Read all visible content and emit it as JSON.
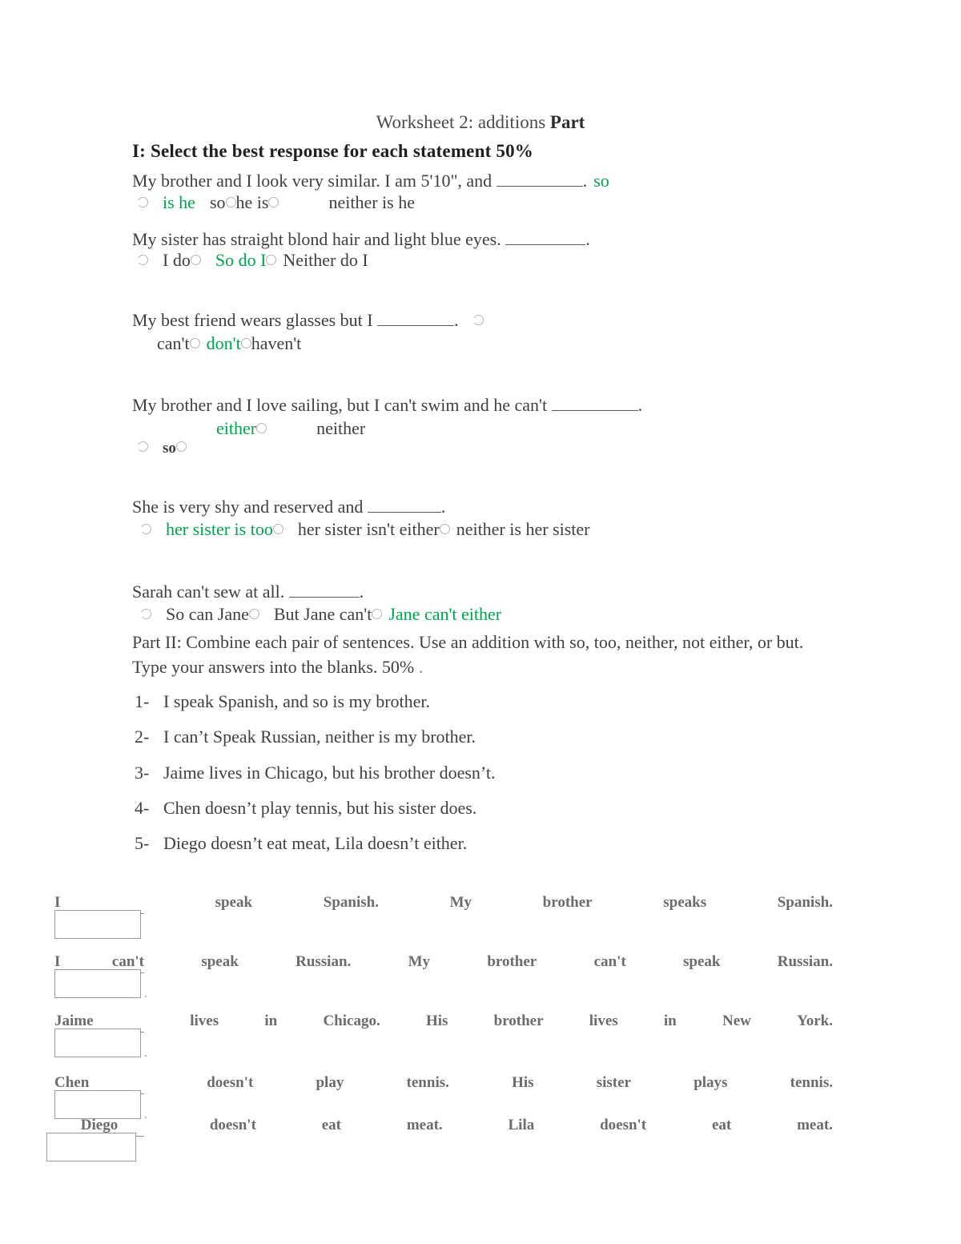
{
  "document": {
    "title_regular": "Worksheet 2: additions ",
    "title_bold": "Part",
    "heading": "I: Select the best response for each statement 50%"
  },
  "part1": {
    "questions": [
      {
        "stem_before": "My brother and I look very similar. I am 5'10\", and ",
        "stem_after": ".",
        "trailing_option": "so",
        "options": [
          "is he",
          "so",
          "he is",
          "neither is he"
        ],
        "selected_answer": "so is he"
      },
      {
        "stem_before": "My sister has straight blond hair and light blue eyes. ",
        "stem_after": ".",
        "options": [
          "I do",
          "So do I",
          "Neither do I"
        ],
        "selected_answer": "So do I"
      },
      {
        "stem_before": "My best friend wears glasses but I ",
        "stem_after": ".",
        "options": [
          "can't",
          "don't",
          "haven't"
        ],
        "selected_answer": "don't"
      },
      {
        "stem_before": "My brother and I love sailing, but I can't swim and he can't ",
        "stem_after": ".",
        "options": [
          "either",
          "neither",
          "so"
        ],
        "selected_answer": "either"
      },
      {
        "stem_before": "She is very shy and reserved and ",
        "stem_after": ".",
        "options": [
          "her sister is too",
          "her sister isn't either",
          "neither is her sister"
        ],
        "selected_answer": "her sister is too"
      },
      {
        "stem_before": "Sarah can't sew at all. ",
        "stem_after": ".",
        "options": [
          "So can Jane",
          "But Jane can't",
          "Jane can't either"
        ],
        "selected_answer": "Jane can't either"
      }
    ]
  },
  "part2": {
    "instructions": "Part II: Combine each pair of sentences. Use an addition with so, too, neither, not either, or but. Type your answers into the blanks. 50%",
    "answers": [
      {
        "number": "1-",
        "text": "I speak Spanish, and so is my brother."
      },
      {
        "number": "2-",
        "text": "I can’t Speak Russian, neither is my brother."
      },
      {
        "number": "3-",
        "text": "Jaime lives in Chicago, but his brother doesn’t."
      },
      {
        "number": "4-",
        "text": "Chen doesn’t play tennis, but his sister does."
      },
      {
        "number": "5-",
        "text": "Diego doesn’t eat meat, Lila doesn’t either."
      }
    ],
    "exercise_rows": [
      {
        "lead": "I",
        "lead_extra": "",
        "words": [
          "speak",
          "Spanish.",
          "My",
          "brother",
          "speaks",
          "Spanish."
        ],
        "input_value": "",
        "trailing_dot": ""
      },
      {
        "lead": "I",
        "lead_extra": "can't",
        "words": [
          "speak",
          "Russian.",
          "My",
          "brother",
          "can't",
          "speak",
          "Russian."
        ],
        "input_value": "",
        "trailing_dot": "."
      },
      {
        "lead": "Jaime",
        "lead_extra": "",
        "words": [
          "lives",
          "in",
          "Chicago.",
          "His",
          "brother",
          "lives",
          "in",
          "New",
          "York."
        ],
        "input_value": "",
        "trailing_dot": "."
      },
      {
        "lead": "Chen",
        "lead_extra": "",
        "words": [
          "doesn't",
          "play",
          "tennis.",
          "His",
          "sister",
          "plays",
          "tennis."
        ],
        "input_value": "",
        "trailing_dot": "."
      },
      {
        "lead": "Diego",
        "lead_extra": "",
        "words": [
          "doesn't",
          "eat",
          "meat.",
          "Lila",
          "doesn't",
          "eat",
          "meat."
        ],
        "input_value": "",
        "trailing_dot": ""
      }
    ]
  },
  "colors": {
    "answer_green": "#00a44f",
    "body_text": "#3f3f3f",
    "rule": "#8d8d8d"
  }
}
